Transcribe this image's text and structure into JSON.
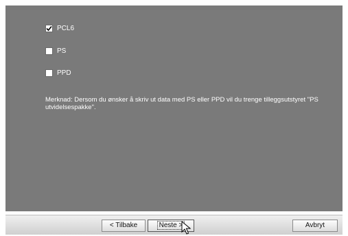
{
  "options": [
    {
      "label": "PCL6",
      "checked": true
    },
    {
      "label": "PS",
      "checked": false
    },
    {
      "label": "PPD",
      "checked": false
    }
  ],
  "note": "Merknad: Dersom du ønsker å skriv ut data med PS eller PPD vil du trenge tilleggsutstyret \"PS utvidelsespakke\".",
  "buttons": {
    "back": "< Tilbake",
    "next": "Neste >",
    "cancel": "Avbryt"
  },
  "colors": {
    "panel": "#7a7a7a",
    "text": "#ffffff"
  }
}
